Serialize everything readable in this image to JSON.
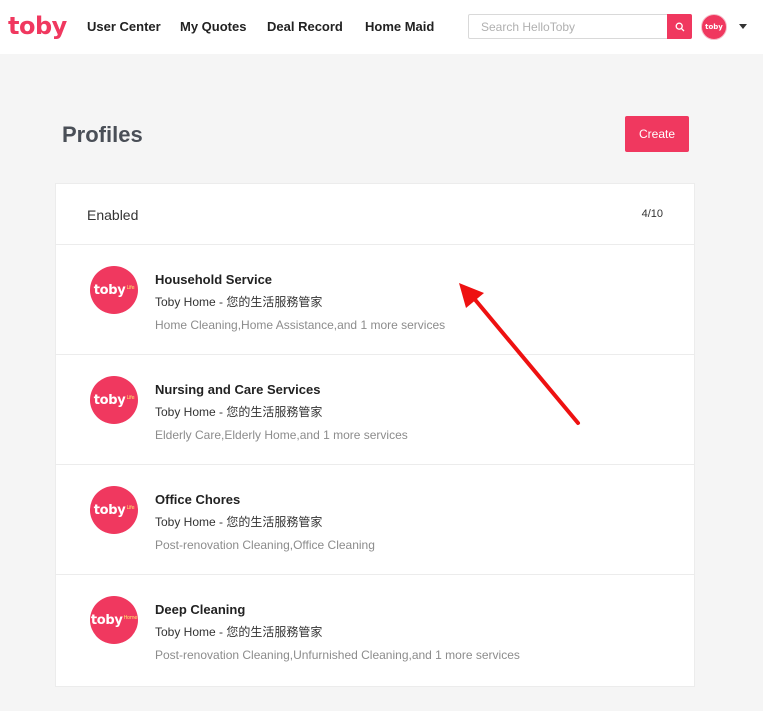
{
  "header": {
    "logo_text": "toby",
    "nav": [
      "User Center",
      "My Quotes",
      "Deal Record",
      "Home Maid"
    ],
    "search_placeholder": "Search HelloToby",
    "avatar_text": "toby",
    "brand_color": "#f0385f"
  },
  "page": {
    "title": "Profiles",
    "create_label": "Create"
  },
  "section": {
    "label": "Enabled",
    "count": "4/10"
  },
  "profiles": [
    {
      "logo_text": "toby",
      "logo_sub": "Life",
      "title": "Household Service",
      "subtitle": "Toby Home - 您的生活服務管家",
      "services": "Home Cleaning,Home Assistance,and 1 more services"
    },
    {
      "logo_text": "toby",
      "logo_sub": "Life",
      "title": "Nursing and Care Services",
      "subtitle": "Toby Home - 您的生活服務管家",
      "services": "Elderly Care,Elderly Home,and 1 more services"
    },
    {
      "logo_text": "toby",
      "logo_sub": "Life",
      "title": "Office Chores",
      "subtitle": "Toby Home - 您的生活服務管家",
      "services": "Post-renovation Cleaning,Office Cleaning"
    },
    {
      "logo_text": "toby",
      "logo_sub": "Home",
      "title": "Deep Cleaning",
      "subtitle": "Toby Home - 您的生活服務管家",
      "services": "Post-renovation Cleaning,Unfurnished Cleaning,and 1 more services"
    }
  ],
  "icons": {
    "search": "search-icon",
    "caret": "chevron-down-icon",
    "annotation": "red-arrow"
  }
}
